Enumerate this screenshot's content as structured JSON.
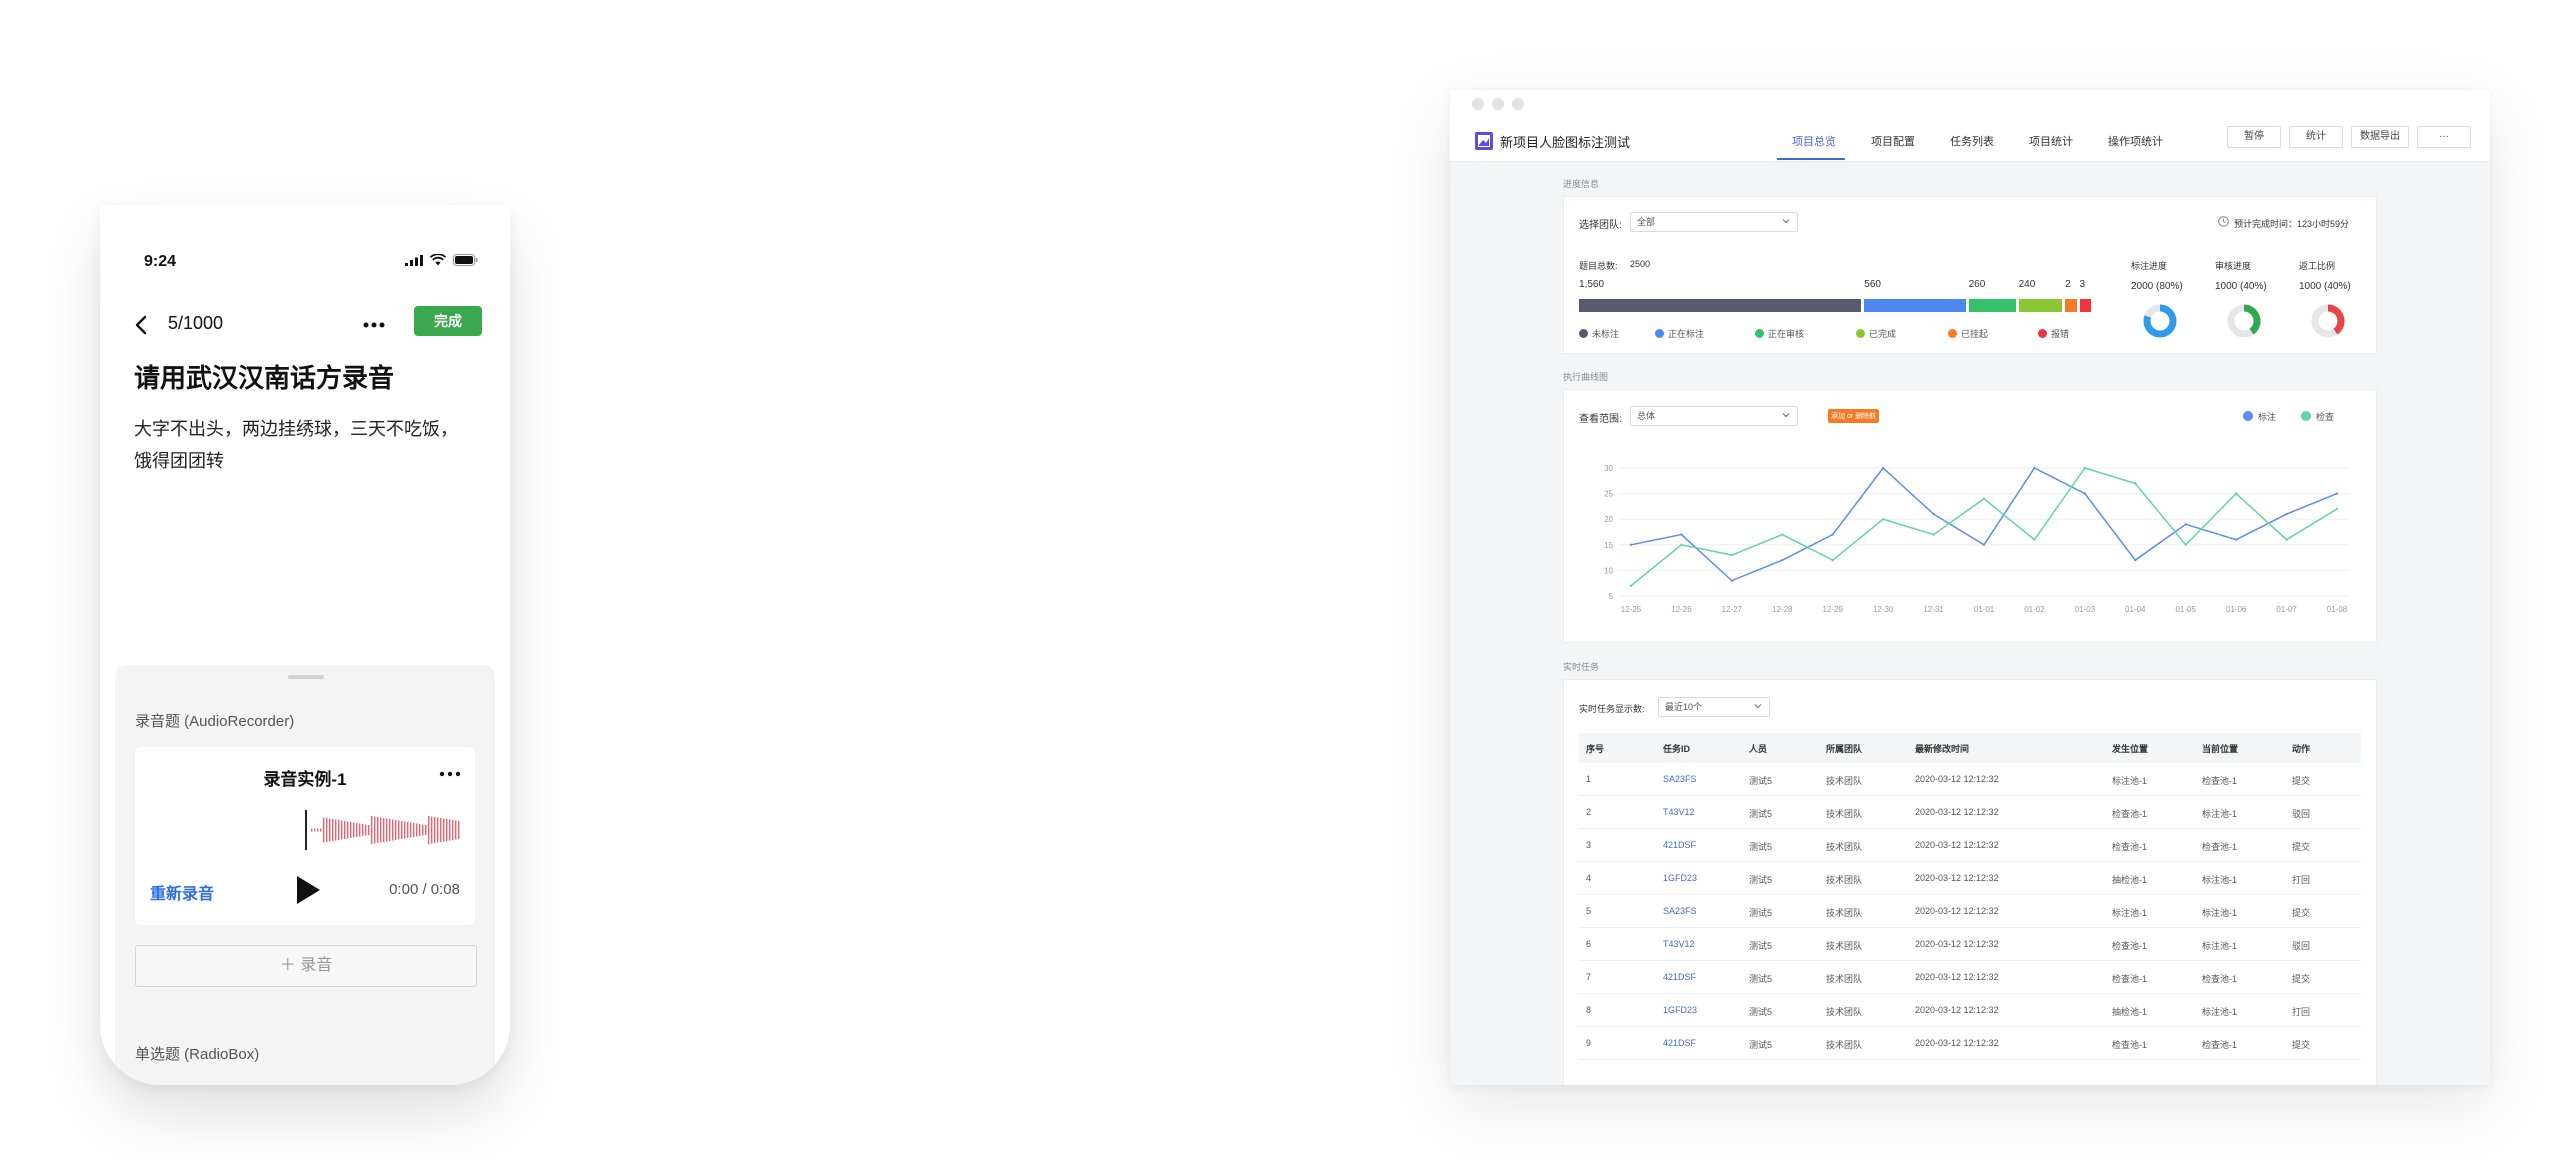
{
  "phone": {
    "status": {
      "time": "9:24"
    },
    "nav": {
      "counter": "5/1000",
      "done_label": "完成"
    },
    "question": {
      "title": "请用武汉汉南话方录音",
      "text": "大字不出头，两边挂绣球，三天不吃饭，饿得团团转"
    },
    "sheet": {
      "section1_label": "录音题 (AudioRecorder)",
      "recorder": {
        "title": "录音实例-1",
        "rerecord_label": "重新录音",
        "time": "0:00 / 0:08"
      },
      "add_label": "＋ 录音",
      "section2_label": "单选题 (RadioBox)"
    }
  },
  "web": {
    "app_title": "新项目人脸图标注测试",
    "tabs": [
      {
        "label": "项目总览",
        "active": true
      },
      {
        "label": "项目配置"
      },
      {
        "label": "任务列表"
      },
      {
        "label": "项目统计"
      },
      {
        "label": "操作项统计"
      }
    ],
    "buttons": {
      "pause": "暂停",
      "stats": "统计",
      "export": "数据导出",
      "more": "···"
    },
    "progress": {
      "section_title": "进度信息",
      "team_label": "选择团队:",
      "team_value": "全部",
      "eta": "预计完成时间：123小时59分",
      "total_label": "题目总数:",
      "total_value": "2500",
      "segments": [
        {
          "label": "1,560",
          "value": 1560,
          "color": "#565b6e"
        },
        {
          "label": "560",
          "value": 560,
          "color": "#4d87f0"
        },
        {
          "label": "260",
          "value": 260,
          "color": "#35c26a"
        },
        {
          "label": "240",
          "value": 240,
          "color": "#8ac833"
        },
        {
          "label": "2",
          "value": 2,
          "color": "#f57a23"
        },
        {
          "label": "3",
          "value": 3,
          "color": "#f0353e"
        }
      ],
      "legend": [
        {
          "label": "未标注",
          "color": "#565b6e"
        },
        {
          "label": "正在标注",
          "color": "#4d87f0"
        },
        {
          "label": "正在审核",
          "color": "#35c26a"
        },
        {
          "label": "已完成",
          "color": "#8ac833"
        },
        {
          "label": "已挂起",
          "color": "#f57a23"
        },
        {
          "label": "报错",
          "color": "#f0353e"
        }
      ],
      "kpis": [
        {
          "title": "标注进度",
          "value": "2000 (80%)",
          "ratio": 0.8,
          "color": "#2f9ae8"
        },
        {
          "title": "审核进度",
          "value": "1000 (40%)",
          "ratio": 0.4,
          "color": "#2fa84f"
        },
        {
          "title": "返工比例",
          "value": "1000 (40%)",
          "ratio": 0.4,
          "color": "#e84545"
        }
      ]
    },
    "trend": {
      "section_title": "执行曲线图",
      "range_label": "查看范围:",
      "range_value": "总体",
      "tag": "添加 or 删除航",
      "legend": [
        {
          "label": "标注",
          "color": "#5b8def"
        },
        {
          "label": "检查",
          "color": "#5ed6a0"
        }
      ]
    },
    "tasks": {
      "section_title": "实时任务",
      "count_label": "实时任务显示数:",
      "count_value": "最近10个",
      "columns": [
        "序号",
        "任务ID",
        "人员",
        "所属团队",
        "最新修改时间",
        "发生位置",
        "当前位置",
        "动作"
      ],
      "rows": [
        [
          "1",
          "SA23FS",
          "测试5",
          "技术团队",
          "2020-03-12 12:12:32",
          "标注池-1",
          "检查池-1",
          "提交"
        ],
        [
          "2",
          "T43V12",
          "测试5",
          "技术团队",
          "2020-03-12 12:12:32",
          "检查池-1",
          "标注池-1",
          "驳回"
        ],
        [
          "3",
          "421DSF",
          "测试5",
          "技术团队",
          "2020-03-12 12:12:32",
          "检查池-1",
          "检查池-1",
          "提交"
        ],
        [
          "4",
          "1GFD23",
          "测试5",
          "技术团队",
          "2020-03-12 12:12:32",
          "抽检池-1",
          "标注池-1",
          "打回"
        ],
        [
          "5",
          "SA23FS",
          "测试5",
          "技术团队",
          "2020-03-12 12:12:32",
          "标注池-1",
          "标注池-1",
          "提交"
        ],
        [
          "6",
          "T43V12",
          "测试5",
          "技术团队",
          "2020-03-12 12:12:32",
          "检查池-1",
          "标注池-1",
          "驳回"
        ],
        [
          "7",
          "421DSF",
          "测试5",
          "技术团队",
          "2020-03-12 12:12:32",
          "检查池-1",
          "检查池-1",
          "提交"
        ],
        [
          "8",
          "1GFD23",
          "测试5",
          "技术团队",
          "2020-03-12 12:12:32",
          "抽检池-1",
          "标注池-1",
          "打回"
        ],
        [
          "9",
          "421DSF",
          "测试5",
          "技术团队",
          "2020-03-12 12:12:32",
          "检查池-1",
          "检查池-1",
          "提交"
        ]
      ]
    }
  },
  "chart_data": {
    "type": "line",
    "x": [
      "12-25",
      "12-26",
      "12-27",
      "12-28",
      "12-29",
      "12-30",
      "12-31",
      "01-01",
      "01-02",
      "01-03",
      "01-04",
      "01-05",
      "01-06",
      "01-07",
      "01-08"
    ],
    "ylim": [
      5,
      30
    ],
    "yticks": [
      5,
      10,
      15,
      20,
      25,
      30
    ],
    "grid": true,
    "legend": "top-right",
    "series": [
      {
        "name": "标注",
        "color": "#5b8def",
        "values": [
          15,
          17,
          8,
          12,
          17,
          30,
          21,
          15,
          30,
          25,
          12,
          19,
          16,
          21,
          25
        ]
      },
      {
        "name": "检查",
        "color": "#5ed6a0",
        "values": [
          7,
          15,
          13,
          17,
          12,
          20,
          17,
          24,
          16,
          30,
          27,
          15,
          25,
          16,
          22
        ]
      }
    ]
  }
}
